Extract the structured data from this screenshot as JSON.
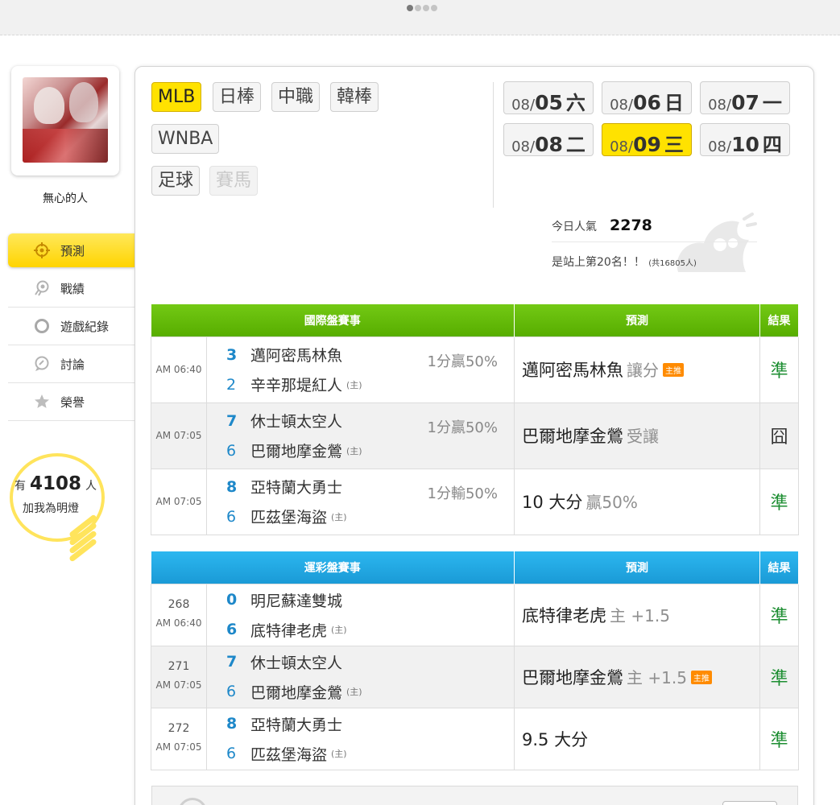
{
  "profile": {
    "name": "無心的人"
  },
  "nav": [
    {
      "label": "預測",
      "icon": "target-icon",
      "active": true
    },
    {
      "label": "戰績",
      "icon": "medal-icon"
    },
    {
      "label": "遊戲紀錄",
      "icon": "circle-icon"
    },
    {
      "label": "討論",
      "icon": "chat-icon"
    },
    {
      "label": "榮譽",
      "icon": "star-icon"
    }
  ],
  "fans": {
    "prefix": "有",
    "count": "4108",
    "suffix": "人",
    "cta": "加我為明燈"
  },
  "league_tabs": [
    "MLB",
    "日棒",
    "中職",
    "韓棒",
    "WNBA",
    "足球",
    "賽馬"
  ],
  "dates": [
    {
      "md": "08/",
      "day": "05",
      "weekday": "六"
    },
    {
      "md": "08/",
      "day": "06",
      "weekday": "日"
    },
    {
      "md": "08/",
      "day": "07",
      "weekday": "一"
    },
    {
      "md": "08/",
      "day": "08",
      "weekday": "二"
    },
    {
      "md": "08/",
      "day": "09",
      "weekday": "三",
      "active": true
    },
    {
      "md": "08/",
      "day": "10",
      "weekday": "四"
    }
  ],
  "popularity": {
    "label": "今日人氣",
    "value": "2278",
    "rank_text": "是站上第20名！！",
    "total": "(共16805人)"
  },
  "intl_table": {
    "headers": [
      "國際盤賽事",
      "預測",
      "結果"
    ],
    "rows": [
      {
        "time": "AM 06:40",
        "teams": [
          {
            "score": "3",
            "name": "邁阿密馬林魚"
          },
          {
            "score": "2",
            "name": "辛辛那堤紅人",
            "home": "(主)"
          }
        ],
        "odds": "1分贏50%",
        "pred": "邁阿密馬林魚",
        "pred_sub": "讓分",
        "badge": "主推",
        "result": "準"
      },
      {
        "time": "AM 07:05",
        "teams": [
          {
            "score": "7",
            "name": "休士頓太空人"
          },
          {
            "score": "6",
            "name": "巴爾地摩金鶯",
            "home": "(主)"
          }
        ],
        "odds": "1分贏50%",
        "pred": "巴爾地摩金鶯",
        "pred_sub": "受讓",
        "result": "囧"
      },
      {
        "time": "AM 07:05",
        "teams": [
          {
            "score": "8",
            "name": "亞特蘭大勇士"
          },
          {
            "score": "6",
            "name": "匹茲堡海盜",
            "home": "(主)"
          }
        ],
        "odds": "1分輸50%",
        "pred": "10 大分",
        "pred_sub": "贏50%",
        "result": "準"
      }
    ]
  },
  "lottery_table": {
    "headers": [
      "運彩盤賽事",
      "預測",
      "結果"
    ],
    "rows": [
      {
        "no": "268",
        "time": "AM 06:40",
        "teams": [
          {
            "score": "0",
            "name": "明尼蘇達雙城"
          },
          {
            "score": "6",
            "name": "底特律老虎",
            "home": "(主)"
          }
        ],
        "pred": "底特律老虎",
        "pred_sub": "主 +1.5",
        "result": "準"
      },
      {
        "no": "271",
        "time": "AM 07:05",
        "teams": [
          {
            "score": "7",
            "name": "休士頓太空人"
          },
          {
            "score": "6",
            "name": "巴爾地摩金鶯",
            "home": "(主)"
          }
        ],
        "pred": "巴爾地摩金鶯",
        "pred_sub": "主 +1.5",
        "badge": "主推",
        "result": "準"
      },
      {
        "no": "272",
        "time": "AM 07:05",
        "teams": [
          {
            "score": "8",
            "name": "亞特蘭大勇士"
          },
          {
            "score": "6",
            "name": "匹茲堡海盜",
            "home": "(主)"
          }
        ],
        "pred": "9.5 大分",
        "result": "準"
      }
    ]
  },
  "colors": {
    "accent_yellow": "#ffe200",
    "intl_header": "#5cb200",
    "lottery_header": "#1fa3de",
    "score_blue": "#1e88c9",
    "win_green": "#1d8e32"
  }
}
